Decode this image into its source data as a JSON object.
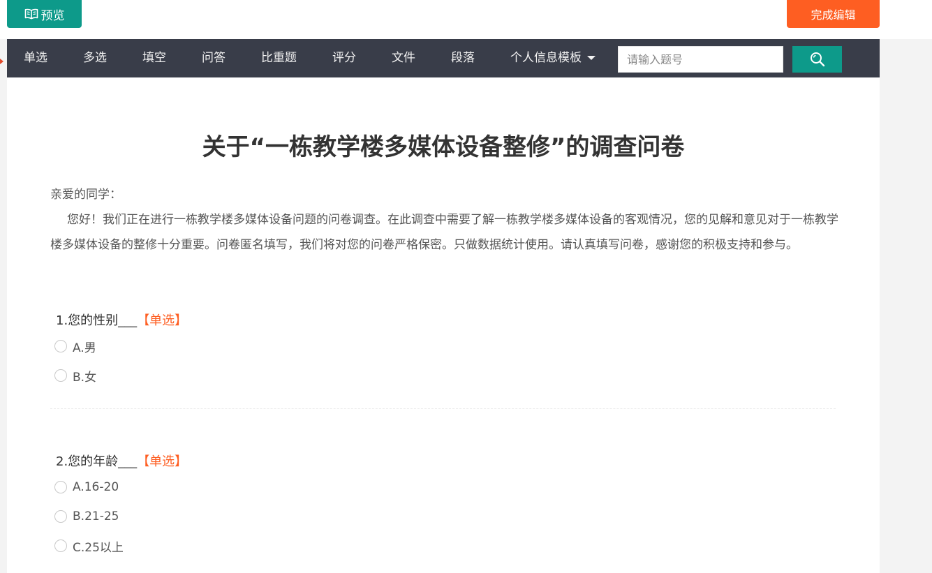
{
  "topbar": {
    "preview_label": "预览",
    "finish_label": "完成编辑"
  },
  "nav": {
    "items": [
      "单选",
      "多选",
      "填空",
      "问答",
      "比重题",
      "评分",
      "文件",
      "段落",
      "个人信息模板"
    ],
    "search_placeholder": "请输入题号"
  },
  "survey": {
    "title": "关于“一栋教学楼多媒体设备整修”的调查问卷",
    "greeting": "亲爱的同学：",
    "intro": "您好！我们正在进行一栋教学楼多媒体设备问题的问卷调查。在此调查中需要了解一栋教学楼多媒体设备的客观情况，您的见解和意见对于一栋教学楼多媒体设备的整修十分重要。问卷匿名填写，我们将对您的问卷严格保密。只做数据统计使用。请认真填写问卷，感谢您的积极支持和参与。",
    "questions": [
      {
        "title": "1.您的性别___",
        "type": "【单选】",
        "options": [
          "A.男",
          "B.女"
        ]
      },
      {
        "title": "2.您的年龄___",
        "type": "【单选】",
        "options": [
          "A.16-20",
          "B.21-25",
          "C.25以上"
        ]
      }
    ]
  },
  "colors": {
    "teal": "#0d9a8a",
    "orange": "#fe5e22",
    "nav_bg": "#393d49"
  },
  "icons": {
    "preview": "open-book-icon",
    "search": "magnifier-icon",
    "dropdown": "caret-down-icon"
  }
}
